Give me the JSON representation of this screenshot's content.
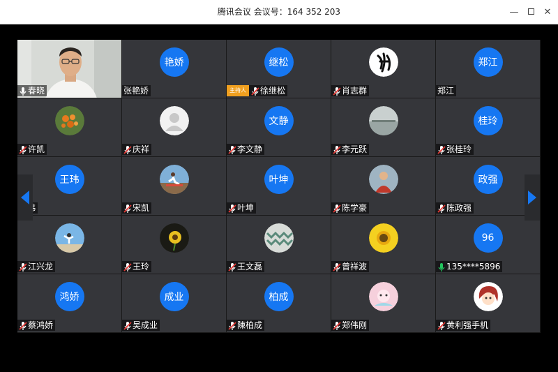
{
  "window": {
    "title": "腾讯会议 会议号：164 352 203",
    "minimize_glyph": "—",
    "close_glyph": "✕"
  },
  "colors": {
    "accent": "#1677f2",
    "host_badge": "#f0a020",
    "tile_bg": "#35363a",
    "mic_active": "#22c55e",
    "mic_muted": "#e53935"
  },
  "participants": [
    {
      "name": "春晓",
      "mic": "on",
      "avatar": "video",
      "host": false
    },
    {
      "name": "张艳娇",
      "mic": "none",
      "avatar": "text",
      "avatar_text": "艳娇",
      "host": false
    },
    {
      "name": "徐继松",
      "mic": "muted",
      "avatar": "text",
      "avatar_text": "继松",
      "host": true
    },
    {
      "name": "肖志群",
      "mic": "muted",
      "avatar": "image",
      "avatar_icon": "calligraphy-icon",
      "host": false
    },
    {
      "name": "郑江",
      "mic": "none",
      "avatar": "text",
      "avatar_text": "郑江",
      "host": false
    },
    {
      "name": "许凯",
      "mic": "muted",
      "avatar": "image",
      "avatar_icon": "flowers-icon",
      "host": false
    },
    {
      "name": "庆祥",
      "mic": "muted",
      "avatar": "image",
      "avatar_icon": "default-user-icon",
      "host": false
    },
    {
      "name": "李文静",
      "mic": "muted",
      "avatar": "text",
      "avatar_text": "文静",
      "host": false
    },
    {
      "name": "李元跃",
      "mic": "muted",
      "avatar": "image",
      "avatar_icon": "lake-icon",
      "host": false
    },
    {
      "name": "张桂玲",
      "mic": "muted",
      "avatar": "text",
      "avatar_text": "桂玲",
      "host": false
    },
    {
      "name": "王玮",
      "mic": "none",
      "avatar": "text",
      "avatar_text": "王玮",
      "host": false
    },
    {
      "name": "宋凯",
      "mic": "muted",
      "avatar": "image",
      "avatar_icon": "runner-icon",
      "host": false
    },
    {
      "name": "叶坤",
      "mic": "muted",
      "avatar": "text",
      "avatar_text": "叶坤",
      "host": false
    },
    {
      "name": "陈学豪",
      "mic": "muted",
      "avatar": "image",
      "avatar_icon": "portrait-icon",
      "host": false
    },
    {
      "name": "陈政强",
      "mic": "muted",
      "avatar": "text",
      "avatar_text": "政强",
      "host": false
    },
    {
      "name": "江兴龙",
      "mic": "muted",
      "avatar": "image",
      "avatar_icon": "sky-figure-icon",
      "host": false
    },
    {
      "name": "王玲",
      "mic": "muted",
      "avatar": "image",
      "avatar_icon": "sunflower-dark-icon",
      "host": false
    },
    {
      "name": "王文磊",
      "mic": "muted",
      "avatar": "image",
      "avatar_icon": "pattern-icon",
      "host": false
    },
    {
      "name": "曾祥波",
      "mic": "muted",
      "avatar": "image",
      "avatar_icon": "sunflower-icon",
      "host": false
    },
    {
      "name": "135****5896",
      "mic": "on",
      "avatar": "text",
      "avatar_text": "96",
      "host": false
    },
    {
      "name": "蔡鸿娇",
      "mic": "muted",
      "avatar": "text",
      "avatar_text": "鸿娇",
      "host": false
    },
    {
      "name": "吴成业",
      "mic": "muted",
      "avatar": "text",
      "avatar_text": "成业",
      "host": false
    },
    {
      "name": "陳柏成",
      "mic": "muted",
      "avatar": "text",
      "avatar_text": "柏成",
      "host": false
    },
    {
      "name": "郑伟刚",
      "mic": "muted",
      "avatar": "image",
      "avatar_icon": "cartoon-pink-icon",
      "host": false
    },
    {
      "name": "黄利强手机",
      "mic": "muted",
      "avatar": "image",
      "avatar_icon": "cartoon-girl-icon",
      "host": false
    }
  ],
  "host_label": "主持人"
}
